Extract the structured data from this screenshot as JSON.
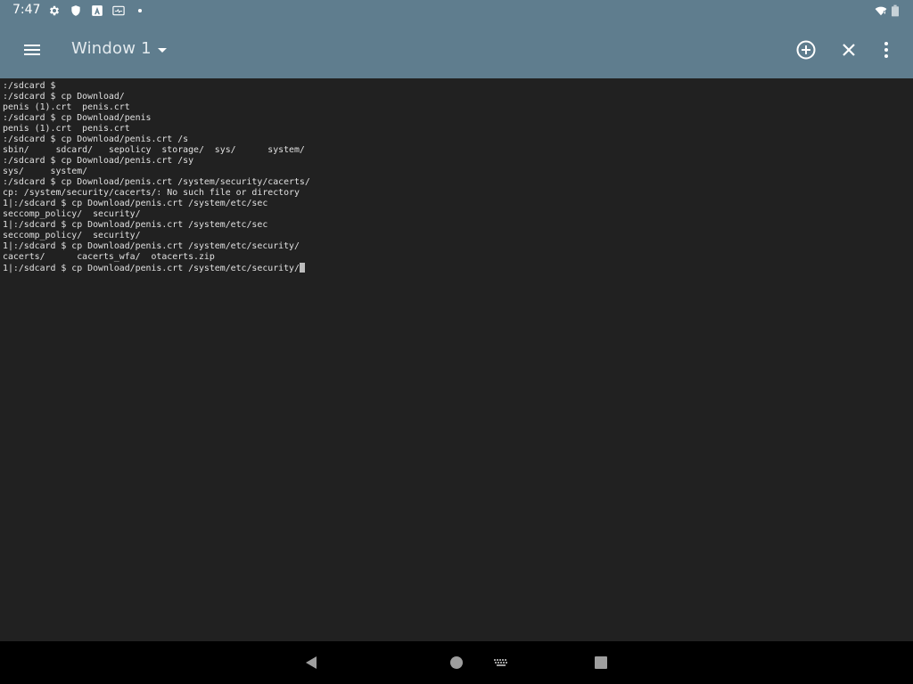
{
  "status_bar": {
    "time": "7:47",
    "icons": [
      "gear-icon",
      "shield-icon",
      "font-a-icon",
      "screen-icon",
      "dot-icon",
      "wifi-icon",
      "battery-icon"
    ]
  },
  "toolbar": {
    "menu_icon": "hamburger-menu-icon",
    "window_title": "Window 1",
    "dropdown_icon": "arrow-drop-down-icon",
    "add_icon": "add-circle-icon",
    "close_icon": "close-icon",
    "more_icon": "more-vert-icon",
    "color": "#5f7d8e"
  },
  "terminal": {
    "background": "#212121",
    "foreground": "#e0e0e0",
    "lines": [
      ":/sdcard $",
      ":/sdcard $ cp Download/",
      "penis (1).crt  penis.crt",
      ":/sdcard $ cp Download/penis",
      "penis (1).crt  penis.crt",
      ":/sdcard $ cp Download/penis.crt /s",
      "sbin/     sdcard/   sepolicy  storage/  sys/      system/",
      ":/sdcard $ cp Download/penis.crt /sy",
      "sys/     system/",
      ":/sdcard $ cp Download/penis.crt /system/security/cacerts/",
      "cp: /system/security/cacerts/: No such file or directory",
      "1|:/sdcard $ cp Download/penis.crt /system/etc/sec",
      "seccomp_policy/  security/",
      "1|:/sdcard $ cp Download/penis.crt /system/etc/sec",
      "seccomp_policy/  security/",
      "1|:/sdcard $ cp Download/penis.crt /system/etc/security/",
      "cacerts/      cacerts_wfa/  otacerts.zip",
      "1|:/sdcard $ cp Download/penis.crt /system/etc/security/"
    ]
  },
  "nav_bar": {
    "icons": [
      "back-icon",
      "home-icon",
      "keyboard-icon",
      "recents-icon"
    ]
  }
}
